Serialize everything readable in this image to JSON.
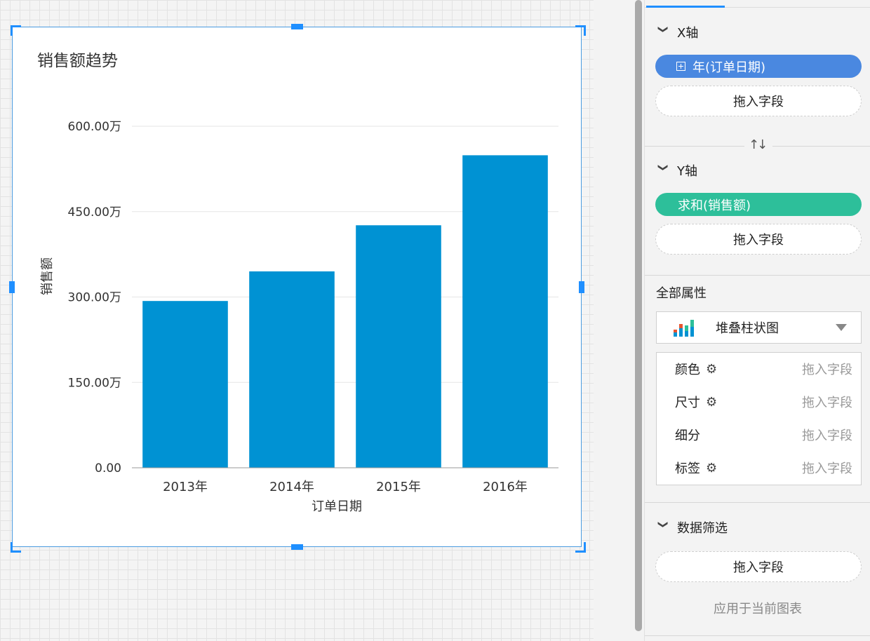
{
  "colors": {
    "bar": "#0092d3",
    "accent": "#1f8fff",
    "x_pill": "#4a88e0",
    "y_pill": "#2dbf9a"
  },
  "chart_data": {
    "type": "bar",
    "title": "销售额趋势",
    "xlabel": "订单日期",
    "ylabel": "销售额",
    "categories": [
      "2013年",
      "2014年",
      "2015年",
      "2016年"
    ],
    "values": [
      2930000,
      3450000,
      4260000,
      5490000
    ],
    "yticks": [
      0,
      1500000,
      3000000,
      4500000,
      6000000
    ],
    "ytick_labels": [
      "0.00",
      "150.00万",
      "300.00万",
      "450.00万",
      "600.00万"
    ],
    "ylim": [
      0,
      6000000
    ],
    "grid": true
  },
  "panel": {
    "x_axis": {
      "title": "X轴",
      "chevron_icon": "chevron-down-icon",
      "field": "年(订单日期)",
      "drop": "拖入字段"
    },
    "swap_icon": "swap-axes-icon",
    "y_axis": {
      "title": "Y轴",
      "chevron_icon": "chevron-down-icon",
      "field": "求和(销售额)",
      "drop": "拖入字段"
    },
    "all_props": {
      "title": "全部属性",
      "chart_type": "堆叠柱状图",
      "chart_type_icon": "stacked-bar-chart-icon",
      "rows": [
        {
          "label": "颜色",
          "gear": true,
          "drop": "拖入字段"
        },
        {
          "label": "尺寸",
          "gear": true,
          "drop": "拖入字段"
        },
        {
          "label": "细分",
          "gear": false,
          "drop": "拖入字段"
        },
        {
          "label": "标签",
          "gear": true,
          "drop": "拖入字段"
        }
      ]
    },
    "filter": {
      "title": "数据筛选",
      "drop": "拖入字段",
      "apply": "应用于当前图表"
    }
  }
}
